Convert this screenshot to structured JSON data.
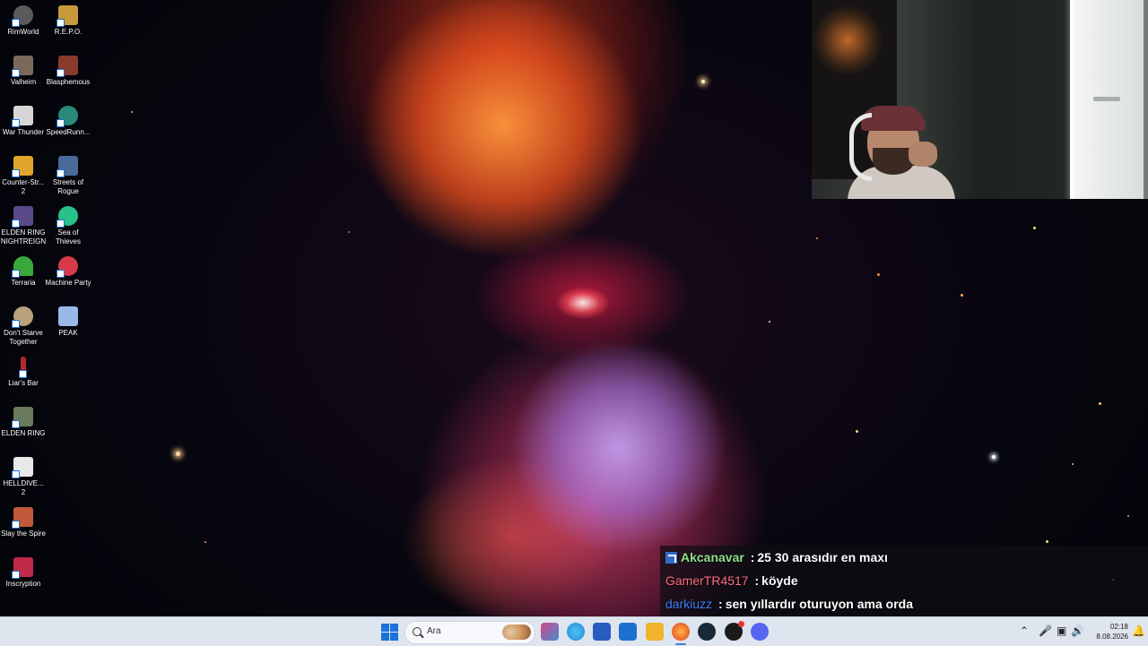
{
  "desktop": {
    "icons": [
      {
        "label": "RimWorld",
        "color": "#5a5a5a"
      },
      {
        "label": "R.E.P.O.",
        "color": "#c69a3a"
      },
      {
        "label": "Valheim",
        "color": "#7a6a5a"
      },
      {
        "label": "Blasphemous",
        "color": "#8a3a2a"
      },
      {
        "label": "War Thunder",
        "color": "#d6d6d6"
      },
      {
        "label": "SpeedRunn...",
        "color": "#2a8a7a"
      },
      {
        "label": "Counter-Str... 2",
        "color": "#e0a52a"
      },
      {
        "label": "Streets of Rogue",
        "color": "#4a6a9a"
      },
      {
        "label": "ELDEN RING NIGHTREIGN",
        "color": "#5a4a8a"
      },
      {
        "label": "Sea of Thieves",
        "color": "#2ac08a"
      },
      {
        "label": "Terraria",
        "color": "#3aa83a"
      },
      {
        "label": "Machine Party",
        "color": "#d83a4a"
      },
      {
        "label": "Don't Starve Together",
        "color": "#b8a27a"
      },
      {
        "label": "PEAK",
        "color": "#9ab8e8"
      },
      {
        "label": "Liar's Bar",
        "color": "#b02a2a"
      },
      {
        "label": "ELDEN RING",
        "color": "#6a7a5a"
      },
      {
        "label": "HELLDIVE... 2",
        "color": "#e8e8e8"
      },
      {
        "label": "Slay the Spire",
        "color": "#c05a3a"
      },
      {
        "label": "Inscryption",
        "color": "#c02a4a"
      }
    ]
  },
  "chat": {
    "messages": [
      {
        "user": "Akcanavar",
        "user_color": "#8fe08f",
        "text": "25 30 arasıdır en maxı",
        "badge": true
      },
      {
        "user": "GamerTR4517",
        "user_color": "#ff6f7f",
        "text": "köyde",
        "badge": false
      },
      {
        "user": "darkiuzz",
        "user_color": "#3f7fff",
        "text": "sen yıllardır oturuyon ama orda",
        "badge": false
      }
    ]
  },
  "taskbar": {
    "search_placeholder": "Ara",
    "apps": [
      {
        "name": "widgets",
        "color": "#d04a8a"
      },
      {
        "name": "edge",
        "color": "#1e88d8"
      },
      {
        "name": "store",
        "color": "#2a5bbf"
      },
      {
        "name": "outlook",
        "color": "#1f6fcf"
      },
      {
        "name": "explorer",
        "color": "#f0b42a"
      },
      {
        "name": "firefox",
        "color": "#e8632a"
      },
      {
        "name": "steam",
        "color": "#1b2838"
      },
      {
        "name": "chat-app",
        "color": "#1a1a1a"
      },
      {
        "name": "discord",
        "color": "#5865f2"
      }
    ],
    "clock_time": "02:18",
    "clock_date": "8.08.2026"
  }
}
